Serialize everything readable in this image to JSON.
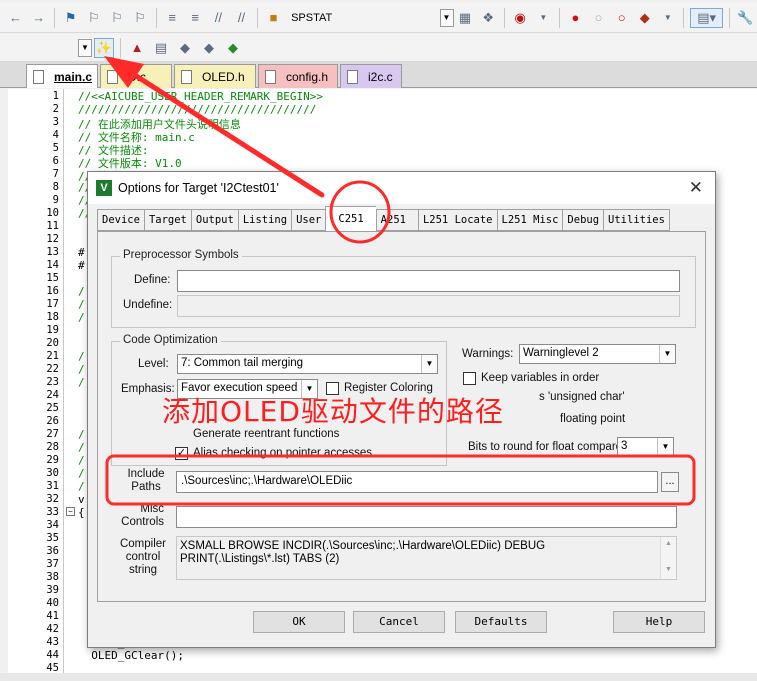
{
  "toolbar1": {
    "target_name": "SPSTAT"
  },
  "file_tabs": [
    {
      "label": "main.c"
    },
    {
      "label": "D.c"
    },
    {
      "label": "OLED.h"
    },
    {
      "label": "config.h"
    },
    {
      "label": "i2c.c"
    }
  ],
  "code_lines": [
    {
      "n": "1",
      "text": "//<<AICUBE_USER_HEADER_REMARK_BEGIN>>"
    },
    {
      "n": "2",
      "text": "////////////////////////////////////"
    },
    {
      "n": "3",
      "text": "// 在此添加用户文件头说明信息"
    },
    {
      "n": "4",
      "text": "// 文件名称: main.c"
    },
    {
      "n": "5",
      "text": "// 文件描述:"
    },
    {
      "n": "6",
      "text": "// 文件版本: V1.0"
    },
    {
      "n": "7",
      "text": "// 修改记录:"
    },
    {
      "n": "8",
      "text": "//"
    },
    {
      "n": "9",
      "text": "//"
    },
    {
      "n": "10",
      "text": "//"
    },
    {
      "n": "11",
      "text": ""
    },
    {
      "n": "12",
      "text": ""
    },
    {
      "n": "13",
      "text": "#"
    },
    {
      "n": "14",
      "text": "#"
    },
    {
      "n": "15",
      "text": ""
    },
    {
      "n": "16",
      "text": "/"
    },
    {
      "n": "17",
      "text": "/"
    },
    {
      "n": "18",
      "text": "/"
    },
    {
      "n": "19",
      "text": ""
    },
    {
      "n": "20",
      "text": ""
    },
    {
      "n": "21",
      "text": "/"
    },
    {
      "n": "22",
      "text": "/"
    },
    {
      "n": "23",
      "text": "/"
    },
    {
      "n": "24",
      "text": ""
    },
    {
      "n": "25",
      "text": ""
    },
    {
      "n": "26",
      "text": ""
    },
    {
      "n": "27",
      "text": "/"
    },
    {
      "n": "28",
      "text": "/"
    },
    {
      "n": "29",
      "text": "/"
    },
    {
      "n": "30",
      "text": "/"
    },
    {
      "n": "31",
      "text": "/"
    },
    {
      "n": "32",
      "text": "v"
    },
    {
      "n": "33",
      "text": "{"
    },
    {
      "n": "34",
      "text": ""
    },
    {
      "n": "35",
      "text": ""
    },
    {
      "n": "36",
      "text": ""
    },
    {
      "n": "37",
      "text": ""
    },
    {
      "n": "38",
      "text": ""
    },
    {
      "n": "39",
      "text": ""
    },
    {
      "n": "40",
      "text": ""
    },
    {
      "n": "41",
      "text": ""
    },
    {
      "n": "42",
      "text": ""
    },
    {
      "n": "43",
      "text": "  OLED_Clear();"
    },
    {
      "n": "44",
      "text": "  OLED_GClear();"
    },
    {
      "n": "45",
      "text": ""
    }
  ],
  "dialog": {
    "title": "Options for Target 'I2Ctest01'",
    "close_glyph": "✕",
    "tabs": [
      "Device",
      "Target",
      "Output",
      "Listing",
      "User",
      "C251",
      "A251",
      "L251 Locate",
      "L251 Misc",
      "Debug",
      "Utilities"
    ],
    "active_tab": "C251",
    "preprocessor": {
      "group_label": "Preprocessor Symbols",
      "define_label": "Define:",
      "define_value": "",
      "undefine_label": "Undefine:",
      "undefine_value": ""
    },
    "code_opt": {
      "group_label": "Code Optimization",
      "level_label": "Level:",
      "level_value": "7: Common tail merging",
      "emphasis_label": "Emphasis:",
      "emphasis_value": "Favor execution speed",
      "register_coloring": "Register Coloring",
      "reentrant": "Generate reentrant functions",
      "alias_checking": "Alias checking on pointer accesses"
    },
    "warnings": {
      "label": "Warnings:",
      "value": "Warninglevel 2",
      "keep_vars": "Keep variables in order",
      "char_hint": "s 'unsigned char'",
      "float_hint": "floating point",
      "bits_label": "Bits to round for float compare:",
      "bits_value": "3"
    },
    "include_paths": {
      "label_line1": "Include",
      "label_line2": "Paths",
      "value": ".\\Sources\\inc;.\\Hardware\\OLEDiic",
      "browse": "..."
    },
    "misc": {
      "label_line1": "Misc",
      "label_line2": "Controls",
      "value": ""
    },
    "compiler_string": {
      "label_line1": "Compiler",
      "label_line2": "control",
      "label_line3": "string",
      "value": "XSMALL BROWSE INCDIR(.\\Sources\\inc;.\\Hardware\\OLEDiic) DEBUG PRINT(.\\Listings\\*.lst) TABS (2)"
    },
    "buttons": {
      "ok": "OK",
      "cancel": "Cancel",
      "defaults": "Defaults",
      "help": "Help"
    }
  },
  "annotation": {
    "text": "添加OLED驱动文件的路径",
    "color": "#ff1e1e"
  },
  "colors": {
    "highlight": "#ff2a2a",
    "comment": "#0a8a0a"
  }
}
